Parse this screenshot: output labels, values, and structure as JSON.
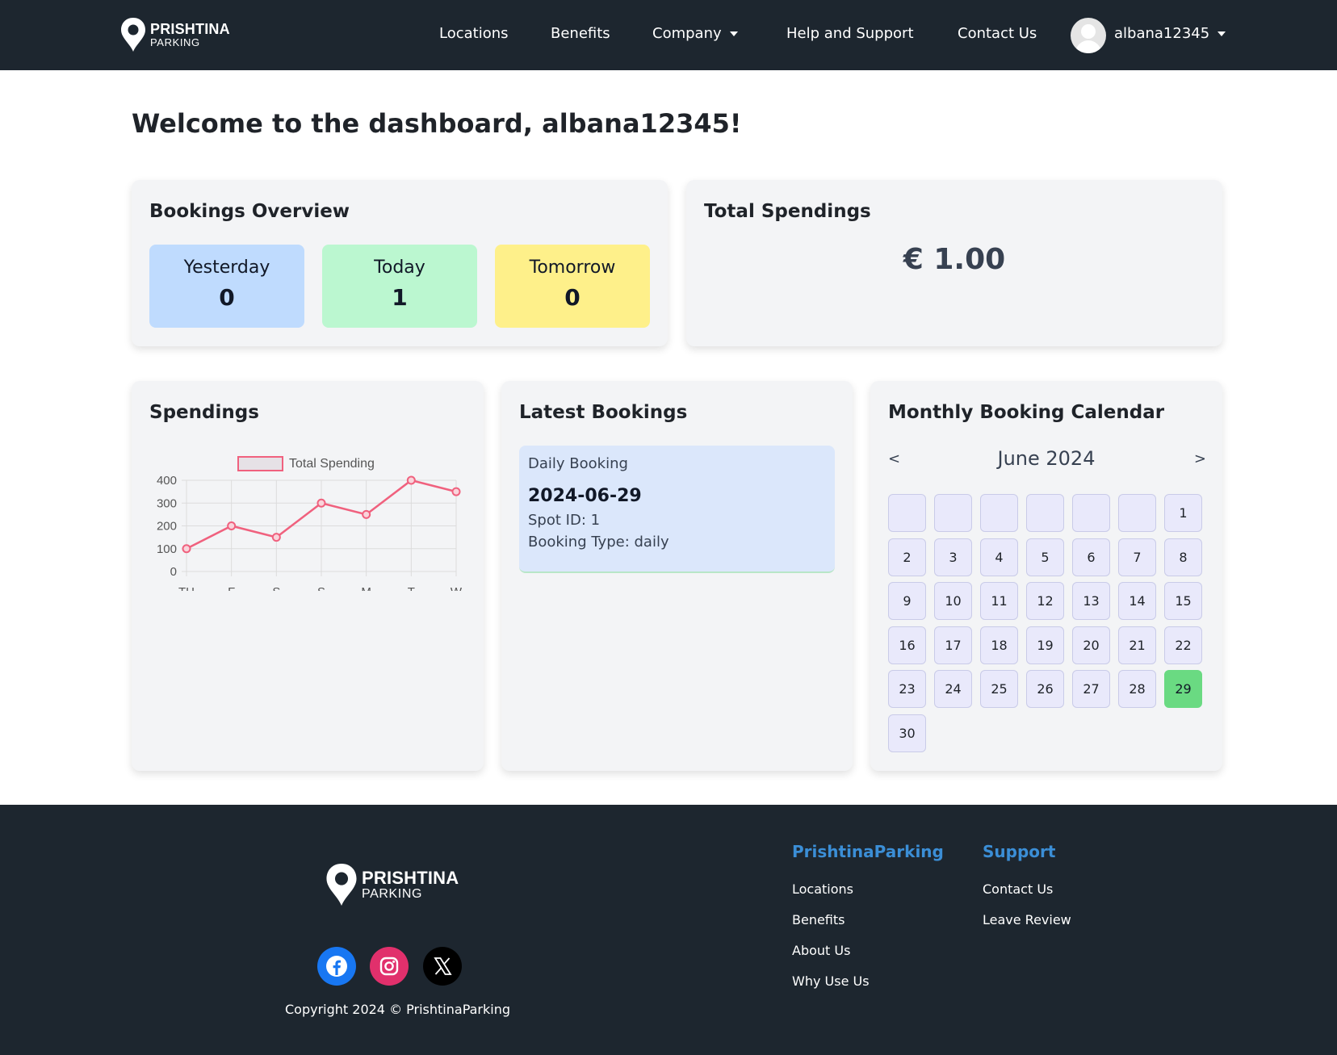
{
  "brand": {
    "word1": "PRISHTINA",
    "word2": "PARKING"
  },
  "nav": {
    "links": [
      "Locations",
      "Benefits",
      "Company",
      "Help and Support",
      "Contact Us"
    ],
    "username": "albana12345"
  },
  "welcome": "Welcome to the dashboard, albana12345!",
  "bookings_overview": {
    "title": "Bookings Overview",
    "tiles": [
      {
        "label": "Yesterday",
        "count": "0",
        "color": "#bfdbfe"
      },
      {
        "label": "Today",
        "count": "1",
        "color": "#bbf7d0"
      },
      {
        "label": "Tomorrow",
        "count": "0",
        "color": "#fef08a"
      }
    ]
  },
  "total_spendings": {
    "title": "Total Spendings",
    "amount": "€ 1.00"
  },
  "spendings": {
    "title": "Spendings"
  },
  "chart_data": {
    "type": "line",
    "categories": [
      "TH",
      "F",
      "S",
      "S",
      "M",
      "T",
      "W"
    ],
    "series": [
      {
        "name": "Total Spending",
        "values": [
          100,
          200,
          150,
          300,
          250,
          400,
          350
        ],
        "color": "#f0617e"
      }
    ],
    "yticks": [
      "0",
      "100",
      "200",
      "300",
      "400"
    ],
    "ylim": [
      0,
      400
    ],
    "grid": true,
    "legend": "top"
  },
  "latest_bookings": {
    "title": "Latest Bookings",
    "items": [
      {
        "type": "Daily Booking",
        "date": "2024-06-29",
        "spot": "Spot ID: 1",
        "booking_type": "Booking Type: daily"
      }
    ]
  },
  "calendar": {
    "title": "Monthly Booking Calendar",
    "prev": "<",
    "next": ">",
    "month": "June 2024",
    "leading_blanks": 6,
    "days": [
      "1",
      "2",
      "3",
      "4",
      "5",
      "6",
      "7",
      "8",
      "9",
      "10",
      "11",
      "12",
      "13",
      "14",
      "15",
      "16",
      "17",
      "18",
      "19",
      "20",
      "21",
      "22",
      "23",
      "24",
      "25",
      "26",
      "27",
      "28",
      "29",
      "30"
    ],
    "booked_days": [
      "29"
    ]
  },
  "footer": {
    "col1": {
      "heading": "PrishtinaParking",
      "links": [
        "Locations",
        "Benefits",
        "About Us",
        "Why Use Us"
      ]
    },
    "col2": {
      "heading": "Support",
      "links": [
        "Contact Us",
        "Leave Review"
      ]
    },
    "social": [
      {
        "name": "facebook-icon",
        "color": "#1877f2"
      },
      {
        "name": "instagram-icon",
        "color": "#e1306c"
      },
      {
        "name": "x-icon",
        "color": "#000000"
      }
    ],
    "copyright": "Copyright 2024 © PrishtinaParking"
  }
}
